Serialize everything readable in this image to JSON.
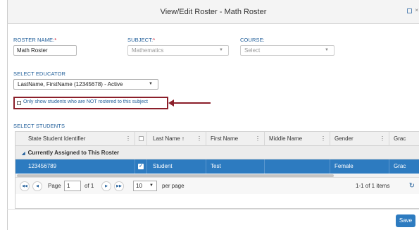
{
  "window": {
    "title": "View/Edit Roster - Math Roster"
  },
  "form": {
    "roster_name_label": "ROSTER NAME:",
    "roster_name_required": "*",
    "roster_name_value": "Math Roster",
    "subject_label": "SUBJECT:",
    "subject_required": "*",
    "subject_value": "Mathematics",
    "course_label": "COURSE:",
    "course_placeholder": "Select",
    "educator_label": "SELECT EDUCATOR",
    "educator_value": "LastName, FirstName (12345678) - Active",
    "not_rostered_label": "Only show students who are NOT rostered to this subject",
    "students_label": "SELECT STUDENTS"
  },
  "grid": {
    "columns": [
      "State Student Identifier",
      "",
      "Last Name ↑",
      "First Name",
      "Middle Name",
      "Gender",
      "Grade"
    ],
    "column_display": [
      "State Student Identifier",
      "",
      "Last Name ↑",
      "First Name",
      "Middle Name",
      "Gender",
      "Grac"
    ],
    "group_label": "Currently Assigned to This Roster",
    "rows": [
      {
        "state_id": "123456789",
        "checked": "✓",
        "last_name": "Student",
        "first_name": "Test",
        "middle_name": "",
        "gender": "Female",
        "grade": "Grac"
      }
    ]
  },
  "pager": {
    "page_label": "Page",
    "page_value": "1",
    "of_label": "of 1",
    "page_size": "10",
    "per_page_label": "per page",
    "items_label": "1-1 of 1 items"
  },
  "buttons": {
    "save_label": "Save"
  },
  "colors": {
    "accent": "#2d7bc0",
    "label_blue": "#1f5d99",
    "callout": "#8b1f2a",
    "required": "#d0021b"
  },
  "icons": [
    "window-restore-icon",
    "column-menu-icon",
    "collapse-triangle-icon",
    "first-page-icon",
    "prev-page-icon",
    "next-page-icon",
    "last-page-icon",
    "refresh-icon",
    "dropdown-caret-icon",
    "checkmark-icon"
  ]
}
